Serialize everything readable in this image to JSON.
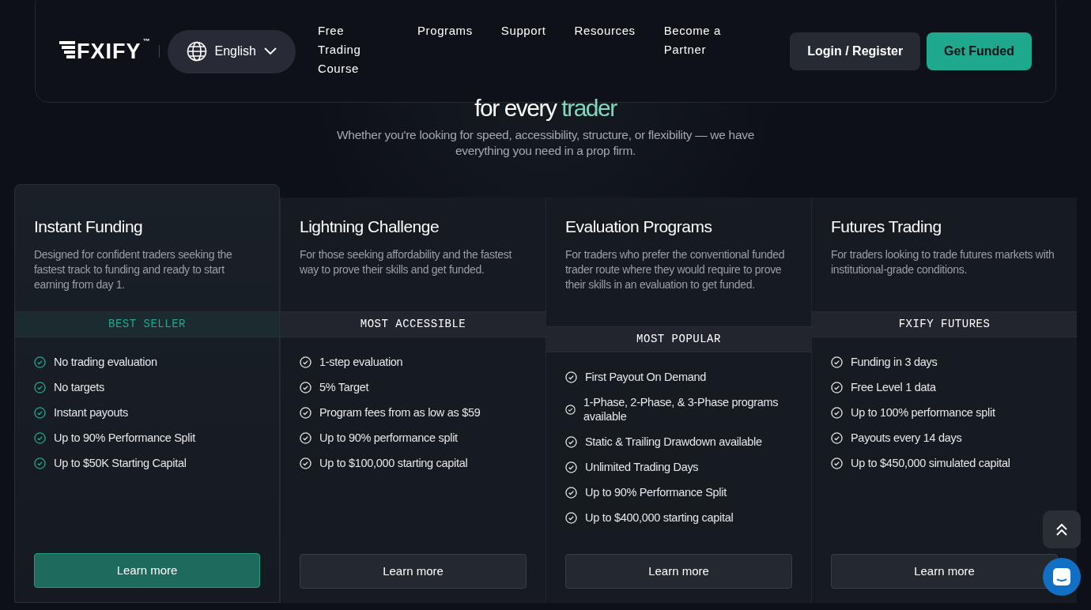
{
  "header": {
    "logo": "FXIFY",
    "trademark": "™",
    "language": "English",
    "nav": [
      {
        "label": "Free Trading Course"
      },
      {
        "label": "Programs"
      },
      {
        "label": "Support"
      },
      {
        "label": "Resources"
      },
      {
        "label": "Become a Partner"
      }
    ],
    "login": "Login / Register",
    "cta": "Get Funded"
  },
  "hero": {
    "heading": "for every",
    "heading_accent": "trader",
    "subtitle": "Whether you're looking for speed, accessibility, structure, or flexibility — we have everything you need in a prop firm."
  },
  "programs": [
    {
      "title": "Instant Funding",
      "description": "Designed for confident traders seeking the fastest track to funding and ready to start earning from day 1.",
      "badge": "BEST SELLER",
      "featured": true,
      "features": [
        "No trading evaluation",
        "No targets",
        "Instant payouts",
        "Up to 90% Performance Split",
        "Up to $50K Starting Capital"
      ],
      "button": "Learn more"
    },
    {
      "title": "Lightning Challenge",
      "description": "For those seeking affordability and the fastest way to prove their skills and get funded.",
      "badge": "MOST ACCESSIBLE",
      "featured": false,
      "features": [
        "1-step evaluation",
        "5% Target",
        "Program fees from as low as $59",
        "Up to 90% performance split",
        "Up to $100,000 starting capital"
      ],
      "button": "Learn more"
    },
    {
      "title": "Evaluation Programs",
      "description": "For traders who prefer the conventional funded trader route where they would require to prove their skills in an evaluation to get funded.",
      "badge": "MOST POPULAR",
      "featured": false,
      "features": [
        "First Payout On Demand",
        "1-Phase, 2-Phase, & 3-Phase programs available",
        "Static & Trailing Drawdown available",
        "Unlimited Trading Days",
        "Up to 90% Performance Split",
        "Up to $400,000 starting capital"
      ],
      "button": "Learn more"
    },
    {
      "title": "Futures Trading",
      "description": "For traders looking to trade futures markets with institutional-grade conditions.",
      "badge": "FXIFY FUTURES",
      "featured": false,
      "features": [
        "Funding in 3 days",
        "Free Level 1 data",
        "Up to 100% performance split",
        "Payouts every 14 days",
        "Up to $450,000 simulated capital"
      ],
      "button": "Learn more"
    }
  ]
}
